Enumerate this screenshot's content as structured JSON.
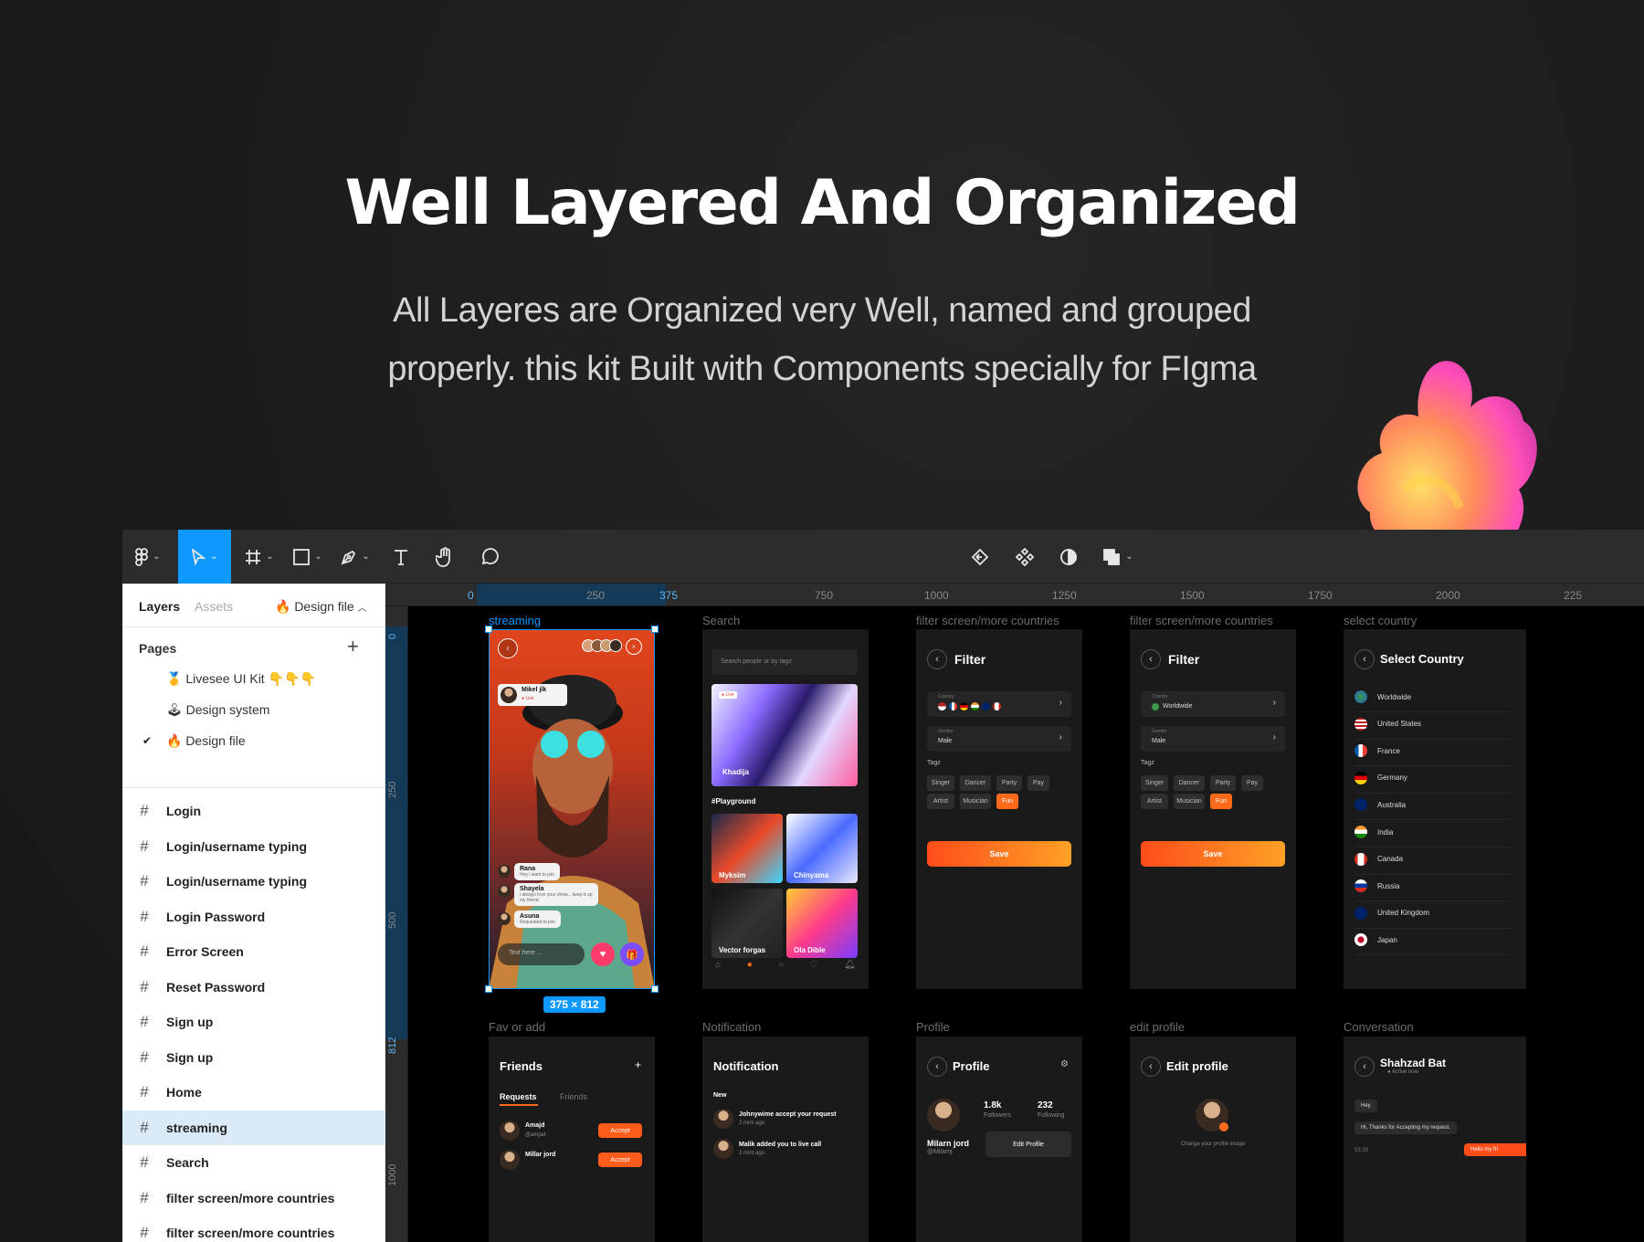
{
  "hero": {
    "title": "Well Layered And Organized",
    "subtitle_line1": "All Layeres are Organized very Well, named and grouped",
    "subtitle_line2": "properly. this kit Built with Components specially for FIgma"
  },
  "toolbar": {
    "icons": [
      "figma-menu-icon",
      "move-tool-icon",
      "frame-tool-icon",
      "shape-tool-icon",
      "pen-tool-icon",
      "text-tool-icon",
      "hand-tool-icon",
      "comment-tool-icon",
      "component-reset-icon",
      "components-icon",
      "contrast-icon",
      "boolean-icon"
    ],
    "active_tool": "move-tool-icon",
    "accent": "#0d99ff"
  },
  "panel": {
    "tabs": {
      "layers": "Layers",
      "assets": "Assets",
      "file": "🔥 Design file"
    },
    "pages_heading": "Pages",
    "pages": [
      {
        "label": "🥇 Livesee UI Kit 👇👇👇"
      },
      {
        "label": "🕹 Design system"
      },
      {
        "label": "🔥 Design file",
        "checked": true
      }
    ],
    "layers": [
      {
        "label": "Login"
      },
      {
        "label": "Login/username typing"
      },
      {
        "label": "Login/username typing"
      },
      {
        "label": "Login Password"
      },
      {
        "label": "Error Screen"
      },
      {
        "label": "Reset Password"
      },
      {
        "label": "Sign up"
      },
      {
        "label": "Sign up"
      },
      {
        "label": "Home"
      },
      {
        "label": "streaming",
        "selected": true
      },
      {
        "label": "Search"
      },
      {
        "label": "filter screen/more countries"
      },
      {
        "label": "filter screen/more countries"
      }
    ]
  },
  "rulers": {
    "top": [
      "0",
      "250",
      "375",
      "750",
      "1000",
      "1250",
      "1500",
      "1750",
      "2000",
      "225"
    ],
    "left": [
      "0",
      "250",
      "500",
      "812",
      "1000"
    ]
  },
  "canvas": {
    "selection_size": "375 × 812",
    "frame_labels": [
      "streaming",
      "Search",
      "filter screen/more countries",
      "filter screen/more countries",
      "select country",
      "Fav or add",
      "Notification",
      "Profile",
      "edit profile",
      "Conversation"
    ],
    "streaming": {
      "host": "Mikel jlk",
      "live": "● Live",
      "comments": [
        {
          "name": "Rana",
          "text": "Hey i want to join"
        },
        {
          "name": "Shayela",
          "text": "i always love your show... keep it up my friend."
        },
        {
          "name": "Asuna",
          "text": "Requested to join"
        }
      ],
      "input_placeholder": "Text here ..."
    },
    "search": {
      "placeholder": "Search people or by tagz",
      "live_badge": "● Live",
      "featured": "Khadija",
      "section": "#Playground",
      "cards": [
        "Myksim",
        "Chinyama",
        "Vector forgas",
        "Ola Dible"
      ]
    },
    "filter": {
      "title": "Filter",
      "country_label": "Country",
      "worldwide": "Worldwide",
      "gender_label": "Gender",
      "gender_value": "Male",
      "tags_label": "Tagz",
      "tags": [
        "Singer",
        "Dancer",
        "Party",
        "Pay",
        "Artist",
        "Musician",
        "Fun"
      ],
      "active_tag": "Fun",
      "save": "Save"
    },
    "select_country": {
      "title": "Select Country",
      "countries": [
        "Worldwide",
        "United States",
        "France",
        "Germany",
        "Australia",
        "India",
        "Canada",
        "Russia",
        "United Kingdom",
        "Japan"
      ]
    },
    "friends": {
      "title": "Friends",
      "plus": "+",
      "tabs": [
        "Requests",
        "Friends"
      ],
      "people": [
        {
          "name": "Amajd",
          "handle": "@amjad",
          "action": "Accept"
        },
        {
          "name": "Millar jord",
          "handle": "",
          "action": "Accept"
        }
      ]
    },
    "notification": {
      "title": "Notification",
      "section": "New",
      "items": [
        {
          "text": "Johnywime accept your request",
          "time": "2 mint ago"
        },
        {
          "text": "Malik added you to live call",
          "time": "3 mint ago"
        }
      ]
    },
    "profile": {
      "title": "Profile",
      "followers_count": "1.8k",
      "followers_label": "Followers",
      "following_count": "232",
      "following_label": "Following",
      "name": "Milarn jord",
      "handle": "@Milarnj",
      "edit_button": "Edit Profile"
    },
    "edit_profile": {
      "title": "Edit profile",
      "hint": "Change your profile image"
    },
    "conversation": {
      "name": "Shahzad Bat",
      "status": "● Active now",
      "messages": [
        "Hey",
        "Hi, Thanks for Accepting  my request."
      ],
      "time": "03:39",
      "reply": "Hello my fri"
    }
  }
}
